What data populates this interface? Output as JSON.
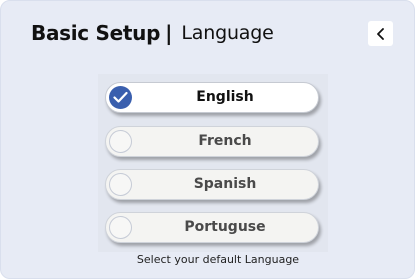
{
  "header": {
    "title_bold": "Basic Setup",
    "separator": "|",
    "title_light": "Language",
    "back_icon": "chevron-left-icon"
  },
  "options": [
    {
      "label": "English",
      "selected": true
    },
    {
      "label": "French",
      "selected": false
    },
    {
      "label": "Spanish",
      "selected": false
    },
    {
      "label": "Portuguse",
      "selected": false
    }
  ],
  "hint": "Select your default Language",
  "colors": {
    "background": "#e7ebf5",
    "selected_radio": "#3a5fae",
    "option_background": "#f4f4f2"
  }
}
